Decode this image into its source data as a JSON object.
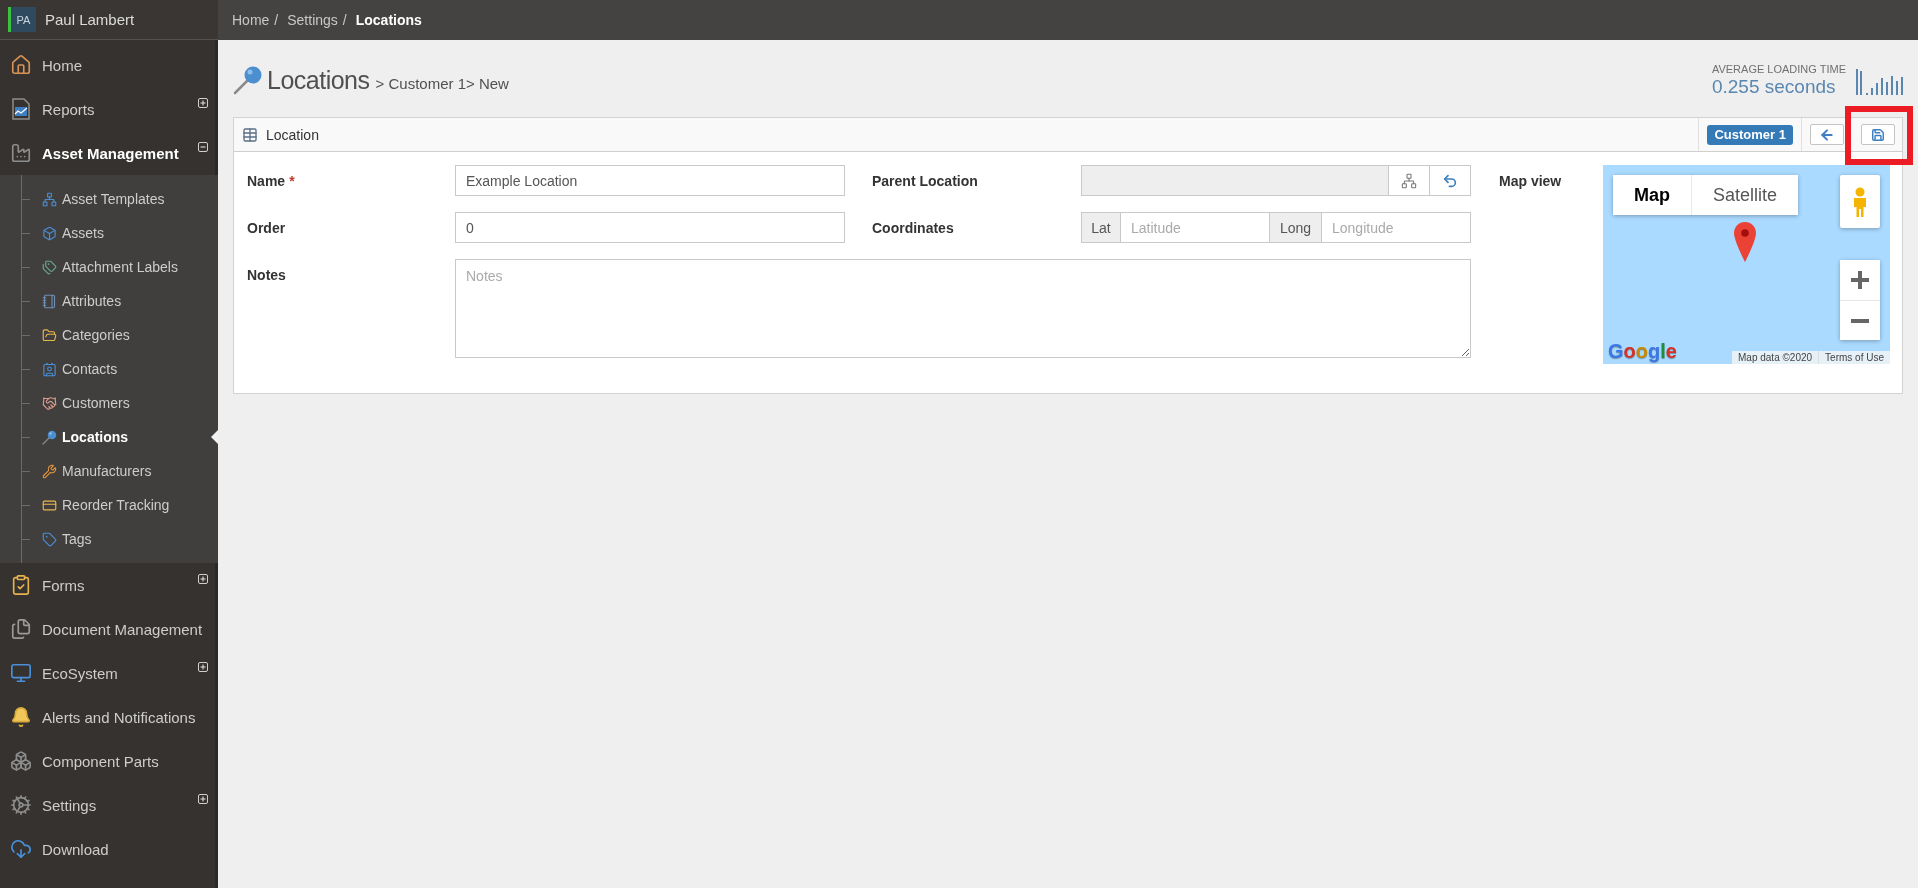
{
  "sidebar": {
    "user": {
      "initials": "PA",
      "name": "Paul Lambert"
    },
    "items": [
      {
        "label": "Home",
        "selected": false
      },
      {
        "label": "Reports",
        "selected": false,
        "expanded": false
      },
      {
        "label": "Asset Management",
        "selected": false,
        "expanded": true,
        "children": [
          {
            "label": "Asset Templates",
            "selected": false
          },
          {
            "label": "Assets",
            "selected": false
          },
          {
            "label": "Attachment Labels",
            "selected": false
          },
          {
            "label": "Attributes",
            "selected": false
          },
          {
            "label": "Categories",
            "selected": false
          },
          {
            "label": "Contacts",
            "selected": false
          },
          {
            "label": "Customers",
            "selected": false
          },
          {
            "label": "Locations",
            "selected": true
          },
          {
            "label": "Manufacturers",
            "selected": false
          },
          {
            "label": "Reorder Tracking",
            "selected": false
          },
          {
            "label": "Tags",
            "selected": false
          }
        ]
      },
      {
        "label": "Forms",
        "selected": false,
        "expanded": false
      },
      {
        "label": "Document Management",
        "selected": false
      },
      {
        "label": "EcoSystem",
        "selected": false,
        "expanded": false
      },
      {
        "label": "Alerts and Notifications",
        "selected": false
      },
      {
        "label": "Component Parts",
        "selected": false
      },
      {
        "label": "Settings",
        "selected": false,
        "expanded": false
      },
      {
        "label": "Download",
        "selected": false
      }
    ]
  },
  "breadcrumb": {
    "separator": "/",
    "items": [
      {
        "label": "Home",
        "current": false
      },
      {
        "label": "Settings",
        "current": false
      },
      {
        "label": "Locations",
        "current": true
      }
    ]
  },
  "page_title": {
    "title": "Locations",
    "trail": "> Customer 1> New"
  },
  "loading_time": {
    "label": "AVERAGE LOADING TIME",
    "value": "0.255 seconds"
  },
  "panel": {
    "title": "Location",
    "badge": "Customer 1",
    "save_button": {
      "highlighted": true
    }
  },
  "form": {
    "name": {
      "label": "Name",
      "required_mark": "*",
      "value": "Example Location"
    },
    "parent_location": {
      "label": "Parent Location",
      "disabled": true
    },
    "order": {
      "label": "Order",
      "value": "0"
    },
    "coordinates": {
      "label": "Coordinates",
      "latitude": {
        "addon": "Lat",
        "placeholder": "Latitude"
      },
      "longitude": {
        "addon": "Long",
        "placeholder": "Longitude"
      }
    },
    "notes": {
      "label": "Notes",
      "placeholder": "Notes"
    },
    "map_view": {
      "label": "Map view",
      "map_types": [
        {
          "label": "Map",
          "selected": true
        },
        {
          "label": "Satellite",
          "selected": false
        }
      ],
      "logo": "Google",
      "attribution": "Map data ©2020",
      "terms": "Terms of Use"
    }
  }
}
